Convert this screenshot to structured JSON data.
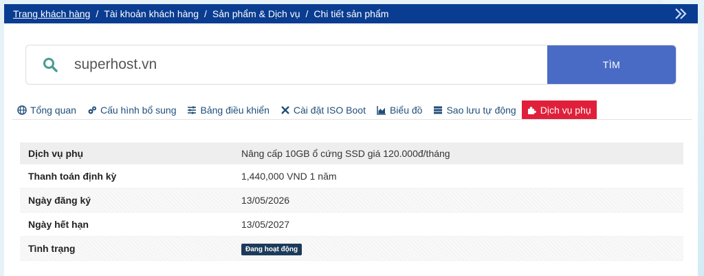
{
  "breadcrumb": {
    "items": [
      {
        "label": "Trang khách hàng",
        "link": true
      },
      {
        "label": "Tài khoản khách hàng",
        "link": false
      },
      {
        "label": "Sản phẩm & Dịch vụ",
        "link": false
      },
      {
        "label": "Chi tiết sản phẩm",
        "link": false
      }
    ],
    "separator": "/"
  },
  "search": {
    "value": "superhost.vn",
    "button_label": "TÌM"
  },
  "tabs": [
    {
      "label": "Tổng quan",
      "icon": "globe-icon"
    },
    {
      "label": "Cấu hình bổ sung",
      "icon": "cogs-icon"
    },
    {
      "label": "Bảng điều khiển",
      "icon": "sliders-icon"
    },
    {
      "label": "Cài đặt ISO Boot",
      "icon": "tools-icon"
    },
    {
      "label": "Biểu đồ",
      "icon": "area-chart-icon"
    },
    {
      "label": "Sao lưu tự động",
      "icon": "server-icon"
    },
    {
      "label": "Dịch vụ phụ",
      "icon": "puzzle-icon",
      "active": true
    }
  ],
  "details": {
    "rows": [
      {
        "label": "Dịch vụ phụ",
        "value": "Nâng cấp 10GB ổ cứng SSD giá 120.000đ/tháng"
      },
      {
        "label": "Thanh toán định kỳ",
        "value": "1,440,000 VND 1 năm"
      },
      {
        "label": "Ngày đăng ký",
        "value": "13/05/2026"
      },
      {
        "label": "Ngày hết hạn",
        "value": "13/05/2027"
      },
      {
        "label": "Tình trạng",
        "badge": "Đang hoạt động"
      }
    ]
  },
  "colors": {
    "header": "#0a3d91",
    "search_button": "#4a6bc5",
    "active_tab": "#e0203a",
    "tab_text": "#1f4e7a",
    "badge": "#1c3b5a",
    "search_icon": "#4a9a95"
  }
}
